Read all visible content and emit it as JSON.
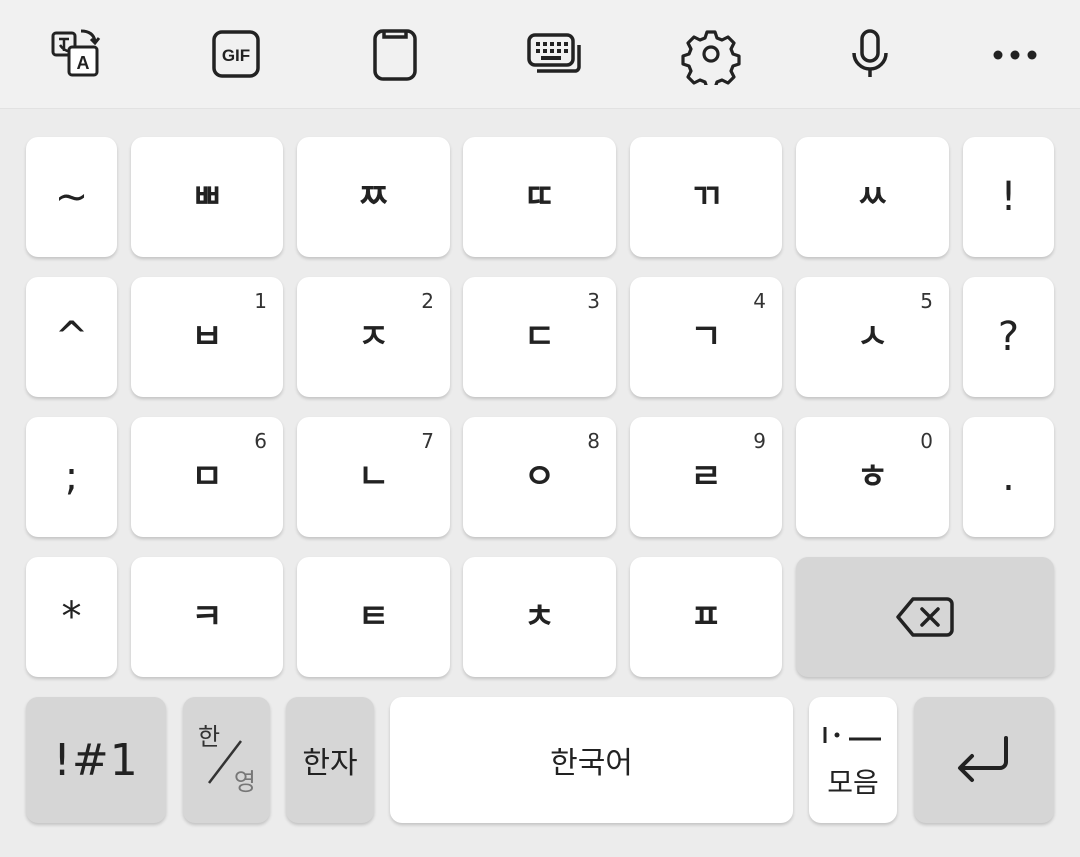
{
  "toolbar": {
    "icons": [
      "translate-icon",
      "gif-icon",
      "clipboard-icon",
      "keyboard-mode-icon",
      "settings-icon",
      "microphone-icon",
      "more-icon"
    ],
    "gif_label": "GIF",
    "translate_letter": "A"
  },
  "keyboard": {
    "row1": [
      {
        "id": "tilde",
        "label": "~"
      },
      {
        "id": "ssangbieup",
        "label": "ㅃ"
      },
      {
        "id": "ssangjieut",
        "label": "ㅉ"
      },
      {
        "id": "ssangdigeut",
        "label": "ㄸ"
      },
      {
        "id": "ssanggiyeok",
        "label": "ㄲ"
      },
      {
        "id": "ssangsiot",
        "label": "ㅆ"
      },
      {
        "id": "exclamation",
        "label": "!"
      }
    ],
    "row2": [
      {
        "id": "caret",
        "label": "^"
      },
      {
        "id": "bieup",
        "label": "ㅂ",
        "hint": "1"
      },
      {
        "id": "jieut",
        "label": "ㅈ",
        "hint": "2"
      },
      {
        "id": "digeut",
        "label": "ㄷ",
        "hint": "3"
      },
      {
        "id": "giyeok",
        "label": "ㄱ",
        "hint": "4"
      },
      {
        "id": "siot",
        "label": "ㅅ",
        "hint": "5"
      },
      {
        "id": "question",
        "label": "?"
      }
    ],
    "row3": [
      {
        "id": "semicolon",
        "label": ";"
      },
      {
        "id": "mieum",
        "label": "ㅁ",
        "hint": "6"
      },
      {
        "id": "nieun",
        "label": "ㄴ",
        "hint": "7"
      },
      {
        "id": "ieung",
        "label": "ㅇ",
        "hint": "8"
      },
      {
        "id": "rieul",
        "label": "ㄹ",
        "hint": "9"
      },
      {
        "id": "hieut",
        "label": "ㅎ",
        "hint": "0"
      },
      {
        "id": "period",
        "label": "."
      }
    ],
    "row4": [
      {
        "id": "asterisk",
        "label": "*"
      },
      {
        "id": "kieuk",
        "label": "ㅋ"
      },
      {
        "id": "tieut",
        "label": "ㅌ"
      },
      {
        "id": "chieut",
        "label": "ㅊ"
      },
      {
        "id": "pieup",
        "label": "ㅍ"
      }
    ],
    "row5": {
      "symbols": "!#1",
      "lang_top": "한",
      "lang_bottom": "영",
      "hanja": "한자",
      "space": "한국어",
      "moeum_top": "ㅣ·ㅡ",
      "moeum_bottom": "모음"
    }
  }
}
